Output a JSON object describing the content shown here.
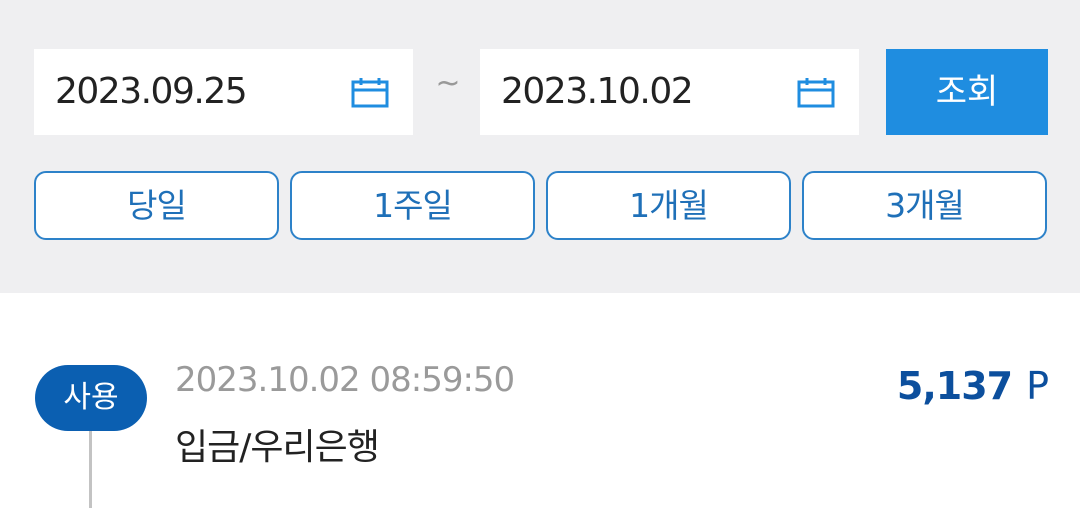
{
  "filter": {
    "start_date": "2023.09.25",
    "separator": "~",
    "end_date": "2023.10.02",
    "search_label": "조회",
    "periods": [
      "당일",
      "1주일",
      "1개월",
      "3개월"
    ]
  },
  "transactions": [
    {
      "type": "사용",
      "datetime": "2023.10.02 08:59:50",
      "description": "입금/우리은행",
      "amount": "5,137",
      "unit": "P"
    }
  ],
  "colors": {
    "accent": "#1f8de0",
    "badge": "#0b5fb1",
    "amount": "#0c4f9d"
  },
  "icons": {
    "calendar": "calendar-icon"
  }
}
